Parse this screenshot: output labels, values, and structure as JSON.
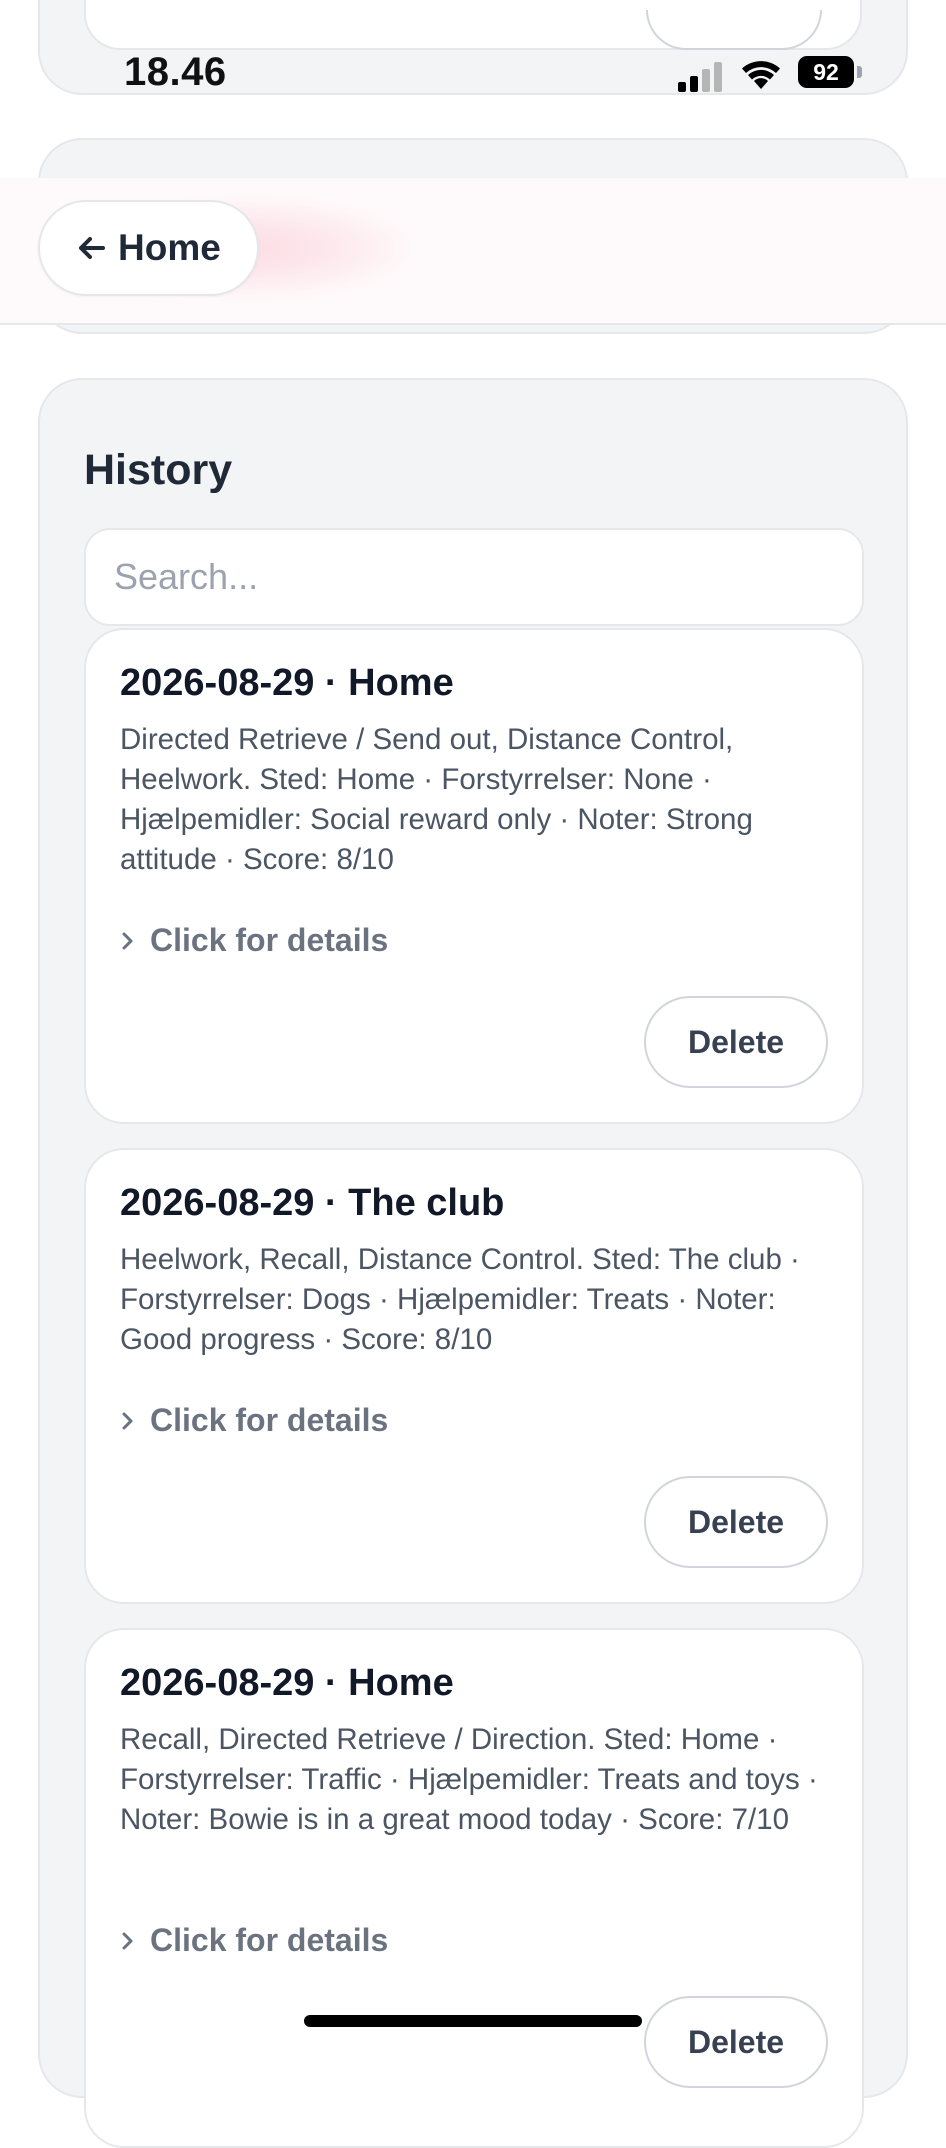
{
  "status_bar": {
    "time": "18.46",
    "battery": "92",
    "signal_icon": "cellular-signal-icon",
    "wifi_icon": "wifi-icon"
  },
  "header": {
    "back_label": "Home",
    "back_icon": "arrow-left-icon"
  },
  "history": {
    "title": "History",
    "search_placeholder": "Search...",
    "details_label": "Click for details",
    "delete_label": "Delete",
    "entries": [
      {
        "title": "2026-08-29 · Home",
        "description": "Directed Retrieve / Send out, Distance Control, Heelwork. Sted: Home · Forstyrrelser: None · Hjælpemidler: Social reward only · Noter: Strong attitude · Score: 8/10"
      },
      {
        "title": "2026-08-29 · The club",
        "description": "Heelwork, Recall, Distance Control. Sted: The club · Forstyrrelser: Dogs · Hjælpemidler: Treats · Noter: Good progress · Score: 8/10"
      },
      {
        "title": "2026-08-29 · Home",
        "description": "Recall, Directed Retrieve / Direction. Sted: Home · Forstyrrelser: Traffic · Hjælpemidler: Treats and toys · Noter: Bowie is in a great mood today · Score: 7/10"
      }
    ]
  },
  "colors": {
    "panel_bg": "#f3f4f6",
    "card_bg": "#ffffff",
    "border": "#e5e7eb",
    "text_primary": "#1f2937",
    "text_secondary": "#4b5563",
    "text_muted": "#6b7280",
    "header_tint": "#fefafb",
    "header_glow": "#f47291"
  }
}
